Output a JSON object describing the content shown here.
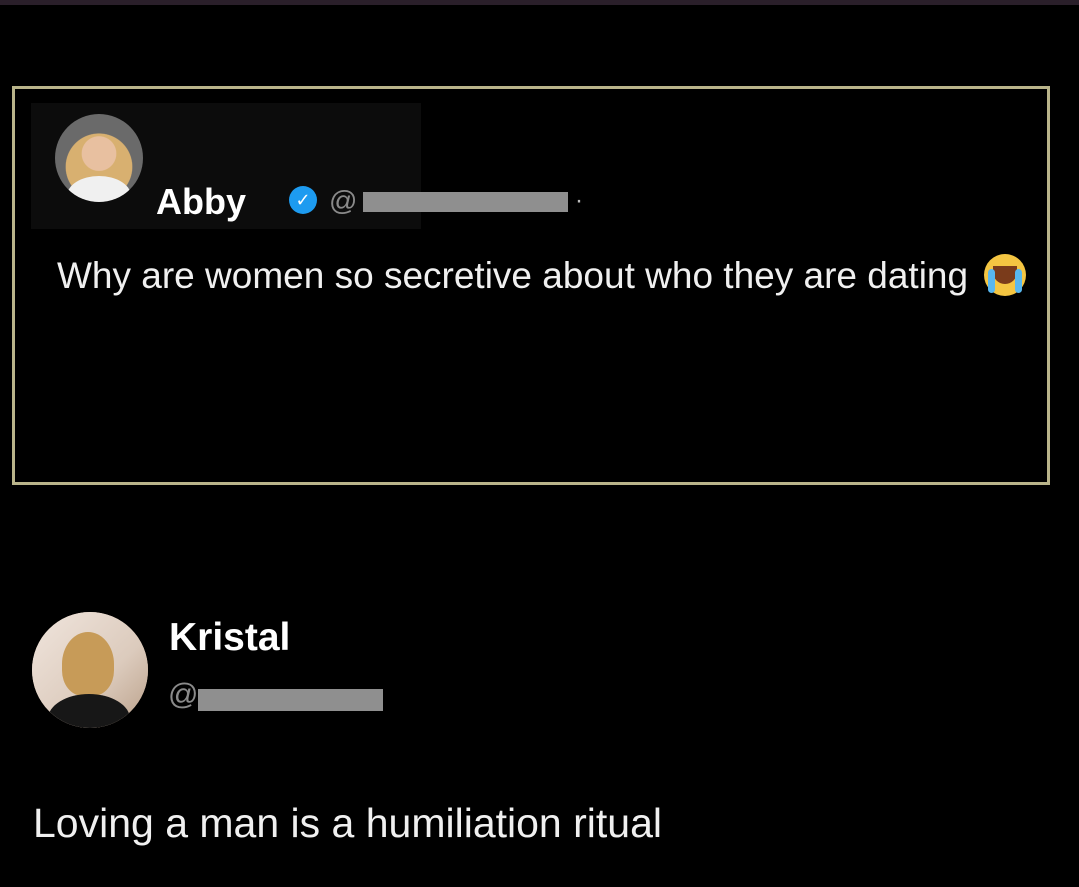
{
  "quoted_tweet": {
    "author_name": "Abby",
    "verified_icon": "check-badge-icon",
    "handle_prefix": "@",
    "separator": "·",
    "text": "Why are women so secretive about who they are dating",
    "emoji": "loudly-crying-face-emoji"
  },
  "reply_tweet": {
    "author_name": "Kristal",
    "handle_prefix": "@",
    "text": "Loving a man is a humiliation ritual"
  },
  "colors": {
    "background": "#000000",
    "quote_border": "#b9b48a",
    "verified_blue": "#1d9bf0",
    "handle_gray": "#8a8a8a"
  }
}
